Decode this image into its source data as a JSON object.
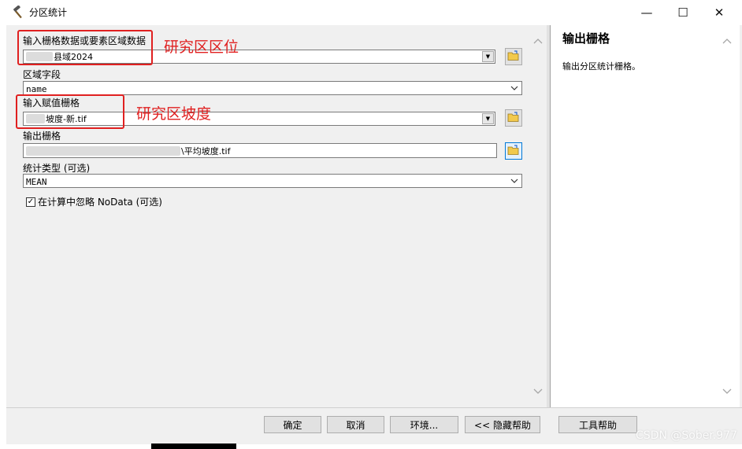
{
  "window": {
    "title": "分区统计",
    "icon": "hammer-icon",
    "minimize_glyph": "—",
    "maximize_glyph": "☐",
    "close_glyph": "✕"
  },
  "form": {
    "zone_input": {
      "label": "输入栅格数据或要素区域数据",
      "value": "县域2024"
    },
    "zone_field": {
      "label": "区域字段",
      "value": "name"
    },
    "value_raster": {
      "label": "输入赋值栅格",
      "value": "坡度-新.tif"
    },
    "output_raster": {
      "label": "输出栅格",
      "value": "\\平均坡度.tif"
    },
    "statistics_type": {
      "label": "统计类型 (可选)",
      "value": "MEAN"
    },
    "ignore_nodata": {
      "label": "在计算中忽略 NoData (可选)",
      "checked": true,
      "check_glyph": "✓"
    }
  },
  "annotations": {
    "zone": "研究区区位",
    "slope": "研究区坡度",
    "color": "#e02020"
  },
  "help": {
    "title": "输出栅格",
    "text": "输出分区统计栅格。"
  },
  "buttons": {
    "ok": "确定",
    "cancel": "取消",
    "environments": "环境...",
    "hide_help": "<< 隐藏帮助",
    "tool_help": "工具帮助"
  },
  "watermark": "CSDN @Sober.977"
}
